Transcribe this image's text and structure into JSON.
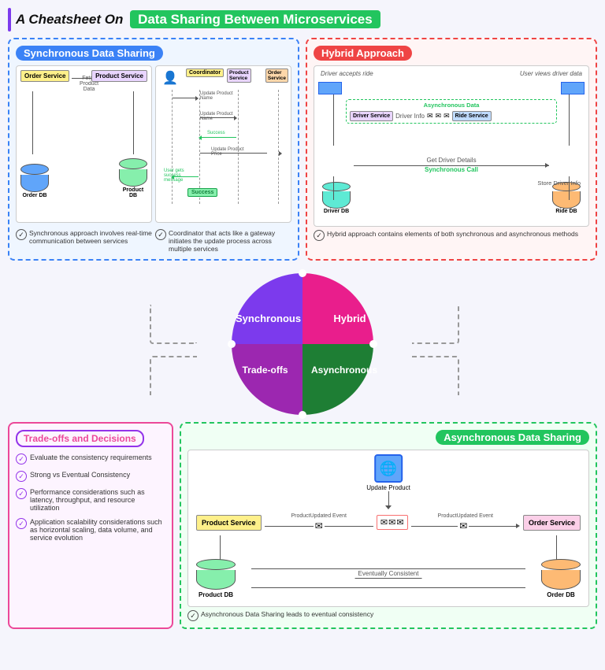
{
  "title": {
    "prefix": "A Cheatsheet On",
    "highlight": "Data Sharing Between Microservices"
  },
  "synchronous": {
    "title": "Synchronous Data Sharing",
    "note1": "Synchronous approach involves real-time communication between services",
    "note2": "Coordinator that acts like a gateway initiates the update process across multiple services",
    "services": {
      "order": "Order Service",
      "product": "Product Service",
      "orderDb": "Order DB",
      "productDb": "Product DB",
      "coordinator": "Coordinator",
      "productSvc": "Product Service",
      "orderSvc": "Order Service"
    },
    "labels": {
      "fetch": "Fetch Product Data",
      "updateProductName": "Update Product Name",
      "updateProductName2": "Update Product Name",
      "success": "Success",
      "success2": "Success",
      "userGets": "User gets success message",
      "updateProductPrice": "Update Product Price"
    }
  },
  "hybrid": {
    "title": "Hybrid Approach",
    "note": "Hybrid approach contains elements of both synchronous and asynchronous methods",
    "asyncLabel": "Asynchronous Data",
    "syncLabel": "Synchronous Call",
    "labels": {
      "driverAccepts": "Driver accepts ride",
      "userViews": "User views driver data",
      "driverInfo": "Driver Info",
      "getDriverDetails": "Get Driver Details",
      "storeDriverInfo": "Store Driver Info"
    },
    "services": {
      "driver": "Driver Service",
      "ride": "Ride Service",
      "driverDb": "Driver DB",
      "rideDb": "Ride DB"
    }
  },
  "pie": {
    "sections": [
      "Synchronous",
      "Hybrid",
      "Trade-offs",
      "Asynchronous"
    ],
    "colors": [
      "#7c3aed",
      "#e91e8c",
      "#9c27b0",
      "#1e7e34"
    ]
  },
  "tradeoffs": {
    "title": "Trade-offs and Decisions",
    "items": [
      "Evaluate the consistency requirements",
      "Strong vs Eventual Consistency",
      "Performance considerations such as latency, throughput, and resource utilization",
      "Application scalability considerations such as horizontal scaling, data volume, and service evolution"
    ]
  },
  "async": {
    "title": "Asynchronous Data Sharing",
    "note": "Asynchronous Data Sharing leads to eventual consistency",
    "labels": {
      "updateProduct": "Update Product",
      "productUpdatedEvent": "ProductUpdated Event",
      "productUpdatedEvent2": "ProductUpdated Event",
      "eventuallyConsistent": "Eventually Consistent"
    },
    "services": {
      "product": "Product Service",
      "order": "Order Service",
      "productDb": "Product DB",
      "orderDb": "Order DB"
    }
  }
}
